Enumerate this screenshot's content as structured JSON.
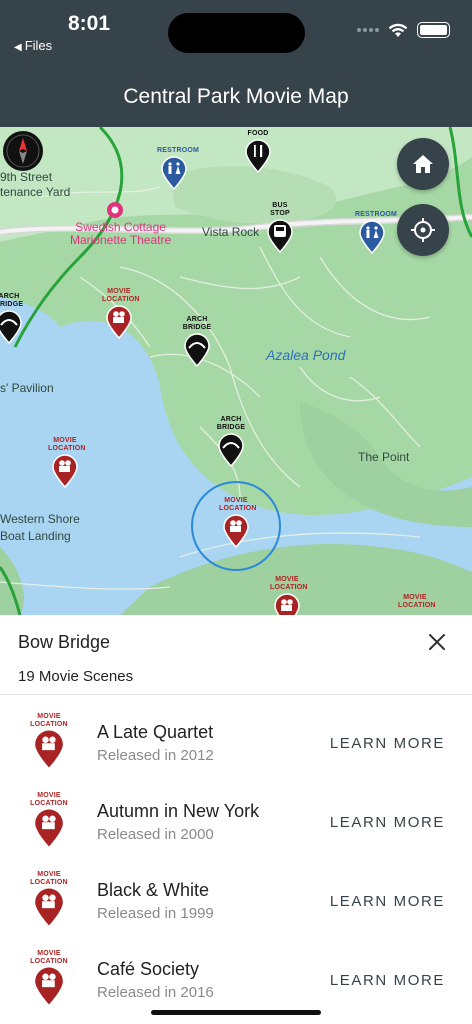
{
  "status_bar": {
    "time": "8:01",
    "back_app": "Files"
  },
  "header": {
    "title": "Central Park Movie Map"
  },
  "map": {
    "labels": {
      "street": "9th Street",
      "yard": "tenance Yard",
      "marionette": "Swedish Cottage\nMarionette Theatre",
      "vista_rock": "Vista Rock",
      "azalea_pond": "Azalea Pond",
      "pavilion": "s' Pavilion",
      "the_point": "The Point",
      "western_shore": "Western Shore\nBoat Landing"
    },
    "pins": {
      "restroom": "RESTROOM",
      "food": "FOOD",
      "bus_stop": "BUS STOP",
      "arch_bridge": "ARCH\nBRIDGE",
      "movie_location": "MOVIE\nLOCATION"
    }
  },
  "sheet": {
    "title": "Bow Bridge",
    "scene_count": "19 Movie Scenes",
    "pin_label": "MOVIE\nLOCATION",
    "items": [
      {
        "title": "A Late Quartet",
        "subtitle": "Released in 2012",
        "action": "LEARN MORE"
      },
      {
        "title": "Autumn in New York",
        "subtitle": "Released in 2000",
        "action": "LEARN MORE"
      },
      {
        "title": "Black & White",
        "subtitle": "Released in 1999",
        "action": "LEARN MORE"
      },
      {
        "title": "Café Society",
        "subtitle": "Released in 2016",
        "action": "LEARN MORE"
      }
    ]
  },
  "colors": {
    "header": "#37434a",
    "movie_pin": "#a82424",
    "restroom_pin": "#2a5aa0",
    "water": "#a9d4f2",
    "park": "#a6d8a6"
  }
}
